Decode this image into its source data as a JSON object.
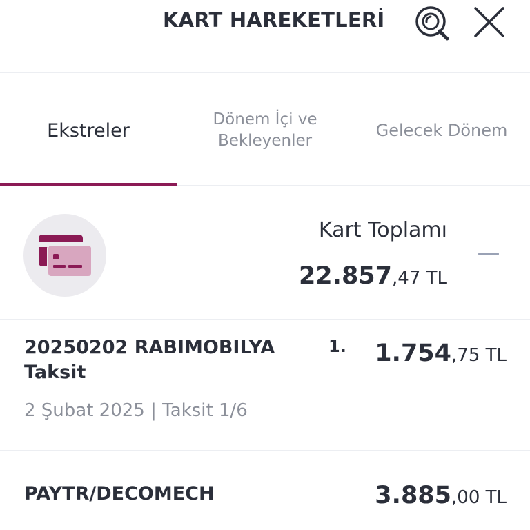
{
  "header": {
    "title": "KART HAREKETLERİ",
    "search_icon": "search-icon",
    "close_icon": "close-icon"
  },
  "tabs": [
    {
      "label": "Ekstreler",
      "active": true
    },
    {
      "label": "Dönem İçi ve Bekleyenler",
      "active": false
    },
    {
      "label": "Gelecek Dönem",
      "active": false
    }
  ],
  "summary": {
    "icon": "credit-card-icon",
    "label": "Kart Toplamı",
    "amount_main": "22.857",
    "amount_decimal": ",47 TL"
  },
  "transactions": [
    {
      "name": "20250202 RABIMOBILYA Taksit",
      "index": "1.",
      "amount_main": "1.754",
      "amount_decimal": ",75 TL",
      "meta": "2 Şubat 2025 | Taksit 1/6"
    },
    {
      "name": "PAYTR/DECOMECH",
      "amount_main": "3.885",
      "amount_decimal": ",00 TL"
    }
  ],
  "colors": {
    "accent": "#8b1a55",
    "card_light": "#d8a6bf",
    "text": "#2b2f3a",
    "muted": "#8b8f99"
  }
}
